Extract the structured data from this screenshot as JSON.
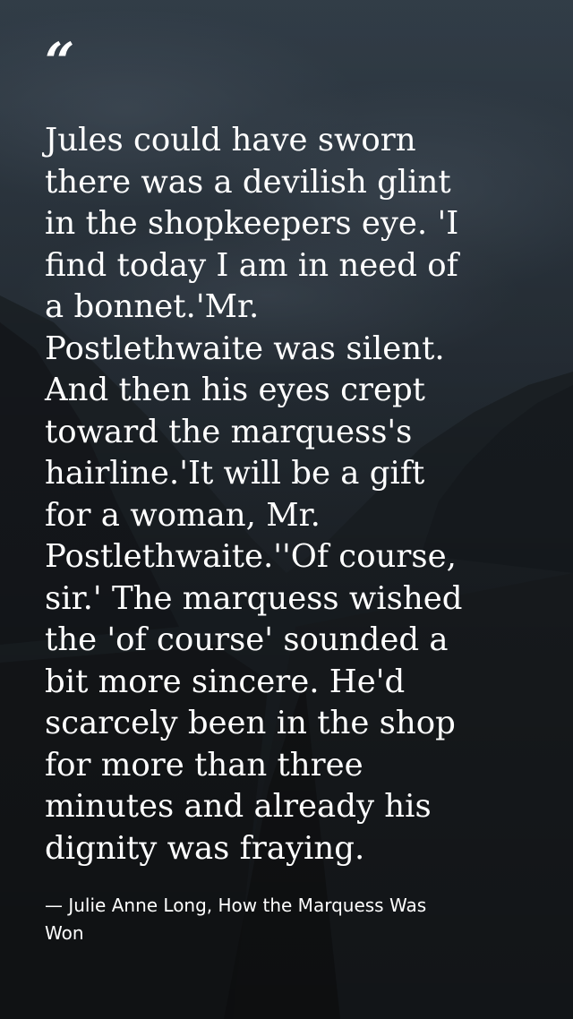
{
  "quote": {
    "mark": "“",
    "text": "Jules could have sworn\nthere was a devilish glint\nin the shopkeepers eye. 'I\nfind today I am in need of\na bonnet.'Mr.\nPostlethwaite was silent.\nAnd then his eyes crept\ntoward the marquess's\nhairline.'It will be a gift\nfor a woman, Mr.\nPostlethwaite.''Of course,\nsir.' The marquess wished\nthe 'of course' sounded a\nbit more sincere. He'd\nscarcely been in the shop\nfor more than three\nminutes and already his\ndignity was fraying."
  },
  "attribution": {
    "text": "— Julie Anne Long, How the Marquess Was\nWon"
  },
  "colors": {
    "text": "#ffffff",
    "background": "#23282d"
  }
}
